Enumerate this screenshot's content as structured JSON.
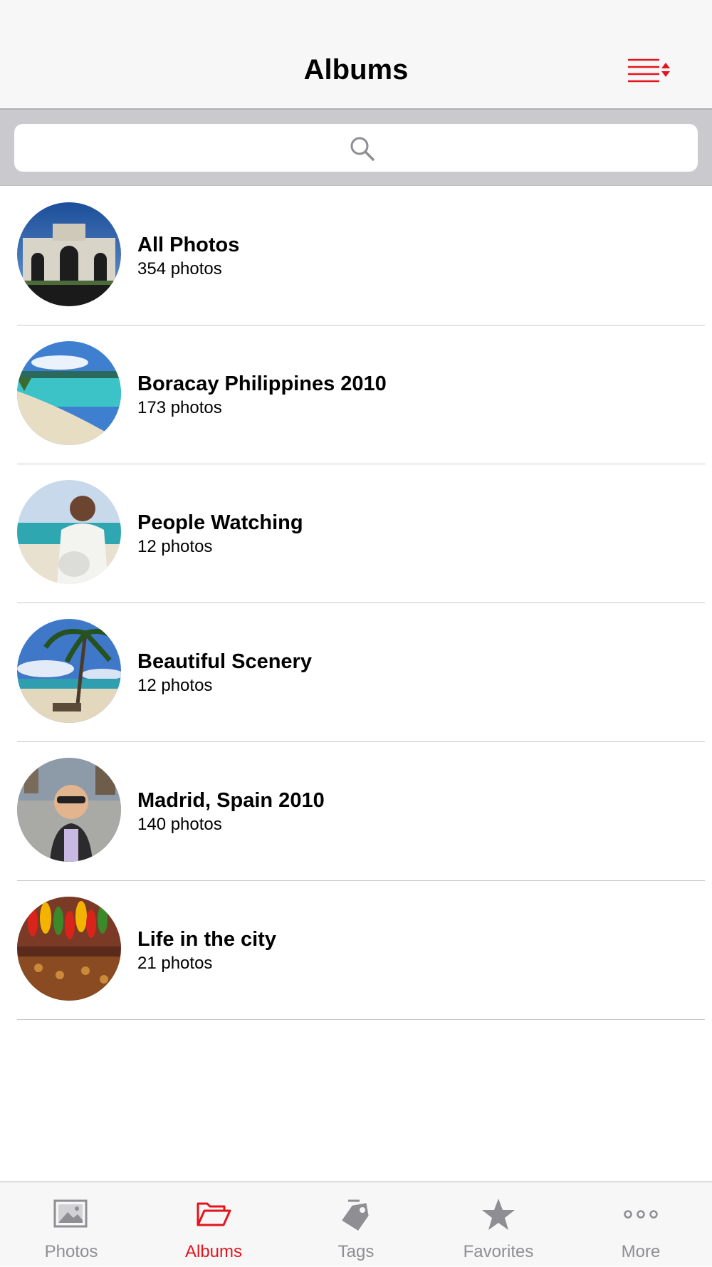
{
  "header": {
    "title": "Albums",
    "sort_icon": "sort-list-icon"
  },
  "search": {
    "icon": "search-icon"
  },
  "albums": [
    {
      "name": "All Photos",
      "count": "354 photos"
    },
    {
      "name": "Boracay Philippines 2010",
      "count": "173 photos"
    },
    {
      "name": "People Watching",
      "count": "12 photos"
    },
    {
      "name": "Beautiful Scenery",
      "count": "12 photos"
    },
    {
      "name": "Madrid, Spain 2010",
      "count": "140 photos"
    },
    {
      "name": "Life in the city",
      "count": "21 photos"
    }
  ],
  "tabs": [
    {
      "label": "Photos",
      "icon": "photos-icon",
      "active": false
    },
    {
      "label": "Albums",
      "icon": "folder-icon",
      "active": true
    },
    {
      "label": "Tags",
      "icon": "tag-icon",
      "active": false
    },
    {
      "label": "Favorites",
      "icon": "star-icon",
      "active": false
    },
    {
      "label": "More",
      "icon": "more-icon",
      "active": false
    }
  ],
  "colors": {
    "accent": "#e3141c",
    "inactive": "#8e8e93",
    "nav_bg": "#f7f7f7",
    "search_bg": "#c9c9ce"
  }
}
